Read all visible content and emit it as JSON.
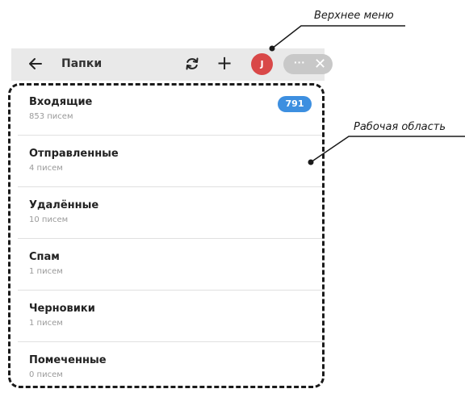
{
  "topbar": {
    "back_icon": "arrow-left-icon",
    "title": "Папки",
    "refresh_icon": "refresh-icon",
    "add_icon": "plus-icon",
    "avatar_letter": "J",
    "avatar_color": "#d94848",
    "more_icon": "ellipsis-icon",
    "close_icon": "close-icon"
  },
  "folders": [
    {
      "name": "Входящие",
      "count": "853 писем",
      "badge": "791"
    },
    {
      "name": "Отправленные",
      "count": "4 писем"
    },
    {
      "name": "Удалённые",
      "count": "10 писем"
    },
    {
      "name": "Спам",
      "count": "1 писем"
    },
    {
      "name": "Черновики",
      "count": "1 писем"
    },
    {
      "name": "Помеченные",
      "count": "0 писем"
    }
  ],
  "annotations": {
    "top_menu": "Верхнее меню",
    "work_area": "Рабочая область"
  },
  "colors": {
    "badge": "#3d8fe0",
    "topbar_bg": "#e9e9e9"
  }
}
